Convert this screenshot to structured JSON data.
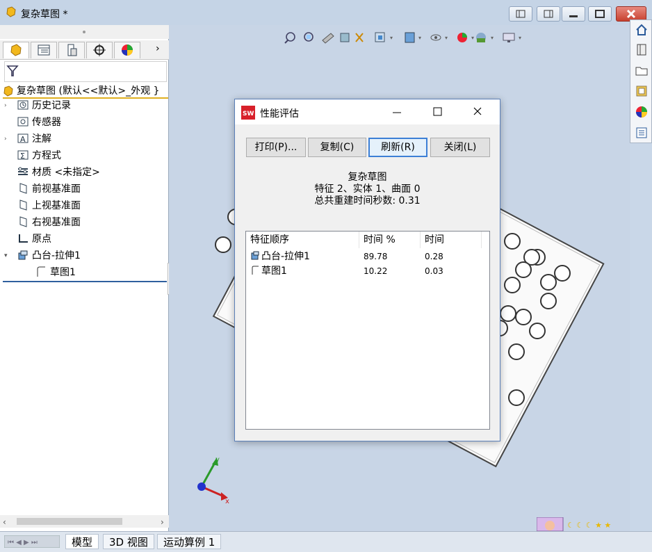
{
  "window": {
    "title": "复杂草图 *"
  },
  "feature_tree": {
    "root_label": "复杂草图  (默认<<默认>_外观 }",
    "items": [
      {
        "label": "历史记录",
        "icon": "history-icon",
        "expandable": true
      },
      {
        "label": "传感器",
        "icon": "sensor-icon",
        "expandable": false
      },
      {
        "label": "注解",
        "icon": "annotation-icon",
        "expandable": true
      },
      {
        "label": "方程式",
        "icon": "equation-icon",
        "expandable": false
      },
      {
        "label": "材质 <未指定>",
        "icon": "material-icon",
        "expandable": false
      },
      {
        "label": "前视基准面",
        "icon": "plane-icon",
        "expandable": false
      },
      {
        "label": "上视基准面",
        "icon": "plane-icon",
        "expandable": false
      },
      {
        "label": "右视基准面",
        "icon": "plane-icon",
        "expandable": false
      },
      {
        "label": "原点",
        "icon": "origin-icon",
        "expandable": false
      },
      {
        "label": "凸台-拉伸1",
        "icon": "extrude-icon",
        "expandable": true
      },
      {
        "label": "草图1",
        "icon": "sketch-icon",
        "expandable": false
      }
    ]
  },
  "bottom_tabs": [
    "模型",
    "3D 视图",
    "运动算例 1"
  ],
  "dialog": {
    "title": "性能评估",
    "buttons": {
      "print": "打印(P)...",
      "copy": "复制(C)",
      "refresh": "刷新(R)",
      "close": "关闭(L)"
    },
    "summary": {
      "name": "复杂草图",
      "counts": "特征 2、实体 1、曲面 0",
      "rebuild": "总共重建时间秒数: 0.31"
    },
    "table": {
      "headers": [
        "特征顺序",
        "时间 %",
        "时间"
      ],
      "rows": [
        {
          "feature": "凸台-拉伸1",
          "percent": "89.78",
          "time": "0.28"
        },
        {
          "feature": "草图1",
          "percent": "10.22",
          "time": "0.03"
        }
      ]
    }
  },
  "axes": {
    "x": "x",
    "y": "y"
  }
}
